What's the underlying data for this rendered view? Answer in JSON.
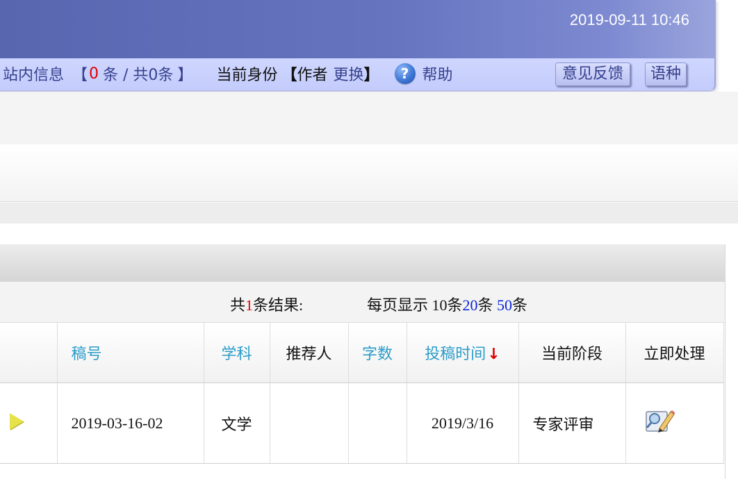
{
  "header": {
    "datetime": "2019-09-11 10:46",
    "messages_label": "站内信息",
    "bracket_open": "【",
    "unread_count": "0",
    "count_text": "条 / 共0条",
    "bracket_close": "】",
    "identity_label": "当前身份",
    "identity_bracket_open": "【",
    "identity_role": "作者",
    "switch_label": "更换",
    "identity_bracket_close": "】",
    "help_label": "帮助",
    "feedback_label": "意见反馈",
    "language_label": "语种",
    "colors": {
      "header_blue": "#5866b0",
      "bar_lavender": "#c3ccfb",
      "unread_red": "#e00000"
    }
  },
  "summary": {
    "total_prefix": "共",
    "total_count": "1",
    "total_suffix": "条结果:",
    "perpage_prefix": "每页显示",
    "option_10": "10条",
    "option_20_num": "20",
    "option_20_unit": "条",
    "option_50_num": "50",
    "option_50_unit": "条"
  },
  "table": {
    "columns": {
      "id": "稿号",
      "subject": "学科",
      "recommender": "推荐人",
      "word_count": "字数",
      "submit_time": "投稿时间",
      "stage": "当前阶段",
      "action": "立即处理"
    },
    "sort_indicator": "↓",
    "rows": [
      {
        "id": "2019-03-16-02",
        "subject": "文学",
        "recommender": "",
        "word_count": "",
        "submit_time": "2019/3/16",
        "stage": "专家评审",
        "action_icon": "edit-icon"
      }
    ]
  }
}
